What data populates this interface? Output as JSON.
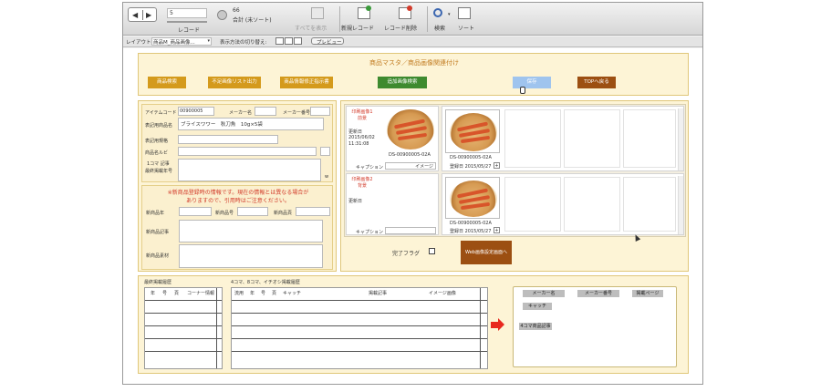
{
  "window": {
    "record_field": "5",
    "record_label": "レコード",
    "count": "66",
    "count_label": "合計 (未ソート)",
    "show_all_label": "すべてを表示",
    "new_record_label": "新規レコード",
    "delete_record_label": "レコード削除",
    "find_label": "検索",
    "sort_label": "ソート"
  },
  "layoutbar": {
    "layout_label": "レイアウト:",
    "layout_value": "商品M_商品画像...",
    "view_as_label": "表示方法の切り替え:",
    "preview_label": "プレビュー"
  },
  "header": {
    "title": "商品マスタ／商品画像関連付け",
    "buttons": [
      {
        "label": "商品検索",
        "color": "#d49a1c"
      },
      {
        "label": "不足画像リスト出力",
        "color": "#d49a1c"
      },
      {
        "label": "商品情報修正指示書",
        "color": "#d49a1c"
      },
      {
        "label": "追加画像検索",
        "color": "#3e8a2f"
      },
      {
        "label": "保存",
        "color": "#9fc4ee"
      },
      {
        "label": "TOPへ戻る",
        "color": "#9c4f12"
      }
    ]
  },
  "item": {
    "item_code_label": "アイテムコード",
    "item_code": "00900005",
    "maker_label": "メーカー名",
    "maker_num_label": "メーカー番号",
    "display_name_label": "表記用商品名",
    "display_name": "ブライスワワー　秋刀魚　10g×5袋",
    "spec_label": "表記用規格",
    "kana_label": "商品名ルビ",
    "feature_label": "1コマ 記事",
    "catalog_label": "最終掲載年号",
    "w_marker": "w",
    "notice": "※新商品登録時の情報です。現在の情報とは異なる場合が\nありますので、引用時はご注意ください。",
    "new_year_label": "新商品年",
    "new_no_label": "新商品号",
    "new_page_label": "新商品頁",
    "new_article_label": "新商品記事",
    "new_material_label": "新商品素材"
  },
  "images": {
    "slot1_title": "印刷画像1\n前景",
    "slot1_update_label": "更新日",
    "slot1_date": "2015/06/02",
    "slot1_time": "11:31:08",
    "slot1_code": "DS-00900005-02A",
    "caption_label": "キャプション",
    "caption_value": "イメージ",
    "reg_code": "DS-00900005-02A",
    "reg_date_label": "登録日 2015/05/27",
    "slot2_title": "印刷画像2\n背景",
    "slot2_update_label": "更新日",
    "slot2_code": "DS-00900005-02A",
    "reg2_date_label": "登録日 2015/05/27",
    "caption2_label": "キャプション",
    "complete_flag_label": "完了フラグ",
    "web_button_label": "Web画像設定画面へ"
  },
  "bottom": {
    "history_title": "最終掲載履歴",
    "history_cols": [
      "年",
      "号",
      "頁",
      "コーナー情報"
    ],
    "feature_title": "4コマ、8コマ、イチオシ掲載履歴",
    "feature_cols": [
      "流用",
      "年",
      "号",
      "頁",
      "キャッチ",
      "掲載記事",
      "イメージ画像"
    ],
    "right_buttons": [
      "メーカー名",
      "メーカー番号",
      "掲載ページ",
      "キャッチ",
      "4コマ商品記事"
    ]
  }
}
